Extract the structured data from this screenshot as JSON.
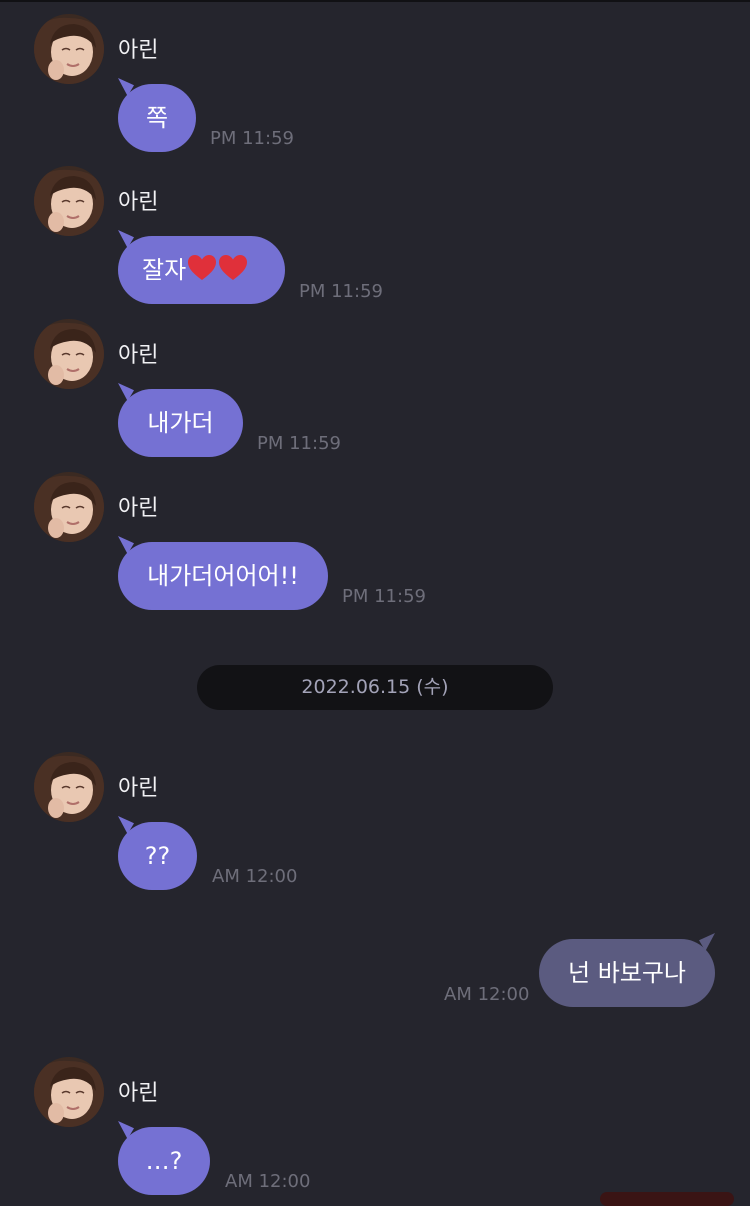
{
  "chat": {
    "sender": "아린",
    "date_divider": "2022.06.15 (수)",
    "messages": [
      {
        "text": "쪽",
        "time": "PM 11:59"
      },
      {
        "text": "잘자",
        "time": "PM 11:59",
        "icons": [
          "heart-icon",
          "heart-icon"
        ]
      },
      {
        "text": "내가더",
        "time": "PM 11:59"
      },
      {
        "text": "내가더어어어!!",
        "time": "PM 11:59"
      },
      {
        "text": "??",
        "time": "AM 12:00"
      },
      {
        "text": "넌 바보구나",
        "time": "AM 12:00",
        "direction": "outgoing"
      },
      {
        "text": "…?",
        "time": "AM 12:00"
      }
    ]
  },
  "colors": {
    "background": "#25252d",
    "incoming_bubble": "#7571d3",
    "outgoing_bubble": "#5b5b80",
    "date_pill": "#121215",
    "timestamp": "#6e6e7a",
    "heart": "#e0303a"
  }
}
